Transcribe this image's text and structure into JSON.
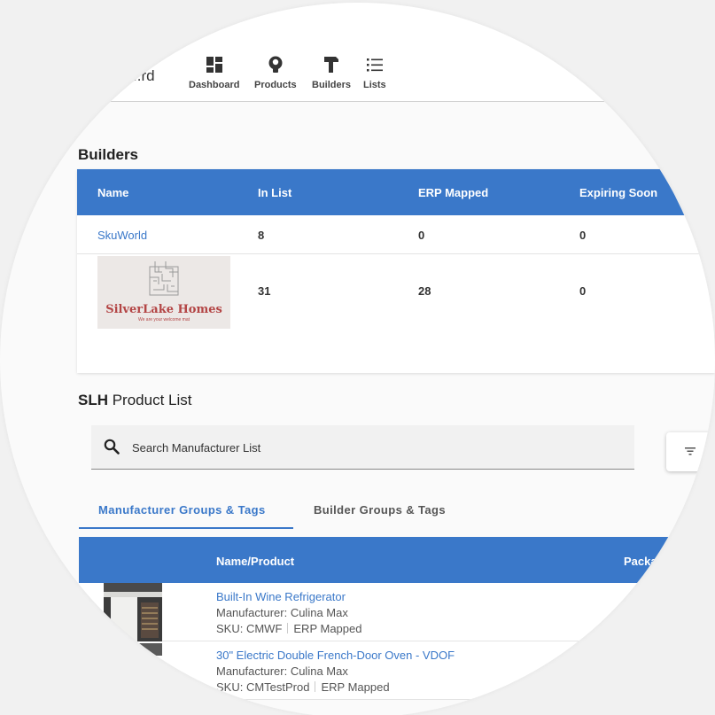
{
  "nav": {
    "brand": "..rd",
    "items": [
      {
        "label": "Dashboard",
        "icon": "dashboard-icon"
      },
      {
        "label": "Products",
        "icon": "lightbulb-icon"
      },
      {
        "label": "Builders",
        "icon": "hammer-icon"
      },
      {
        "label": "Lists",
        "icon": "list-icon"
      }
    ]
  },
  "builders": {
    "title": "Builders",
    "columns": [
      "Name",
      "In List",
      "ERP Mapped",
      "Expiring Soon"
    ],
    "rows": [
      {
        "name": "SkuWorld",
        "in_list": "8",
        "erp_mapped": "0",
        "expiring_soon": "0"
      },
      {
        "logo_title": "SilverLake Homes",
        "logo_tagline": "We are your welcome mat",
        "in_list": "31",
        "erp_mapped": "28",
        "expiring_soon": "0"
      }
    ]
  },
  "product_list": {
    "title_prefix": "SLH",
    "title_suffix": " Product List",
    "search_placeholder": "Search Manufacturer List",
    "tabs": [
      "Manufacturer Groups & Tags",
      "Builder Groups & Tags"
    ],
    "columns": [
      "Name/Product",
      "Packa"
    ],
    "items": [
      {
        "name": "Built-In Wine Refrigerator",
        "manufacturer": "Manufacturer: Culina Max",
        "sku": "SKU: CMWF",
        "status": "ERP Mapped"
      },
      {
        "name": "30\" Electric Double French-Door Oven - VDOF",
        "manufacturer": "Manufacturer: Culina Max",
        "sku": "SKU: CMTestProd",
        "status": "ERP Mapped"
      }
    ]
  },
  "colors": {
    "primary": "#3a78c9",
    "logo_red": "#b34545"
  }
}
